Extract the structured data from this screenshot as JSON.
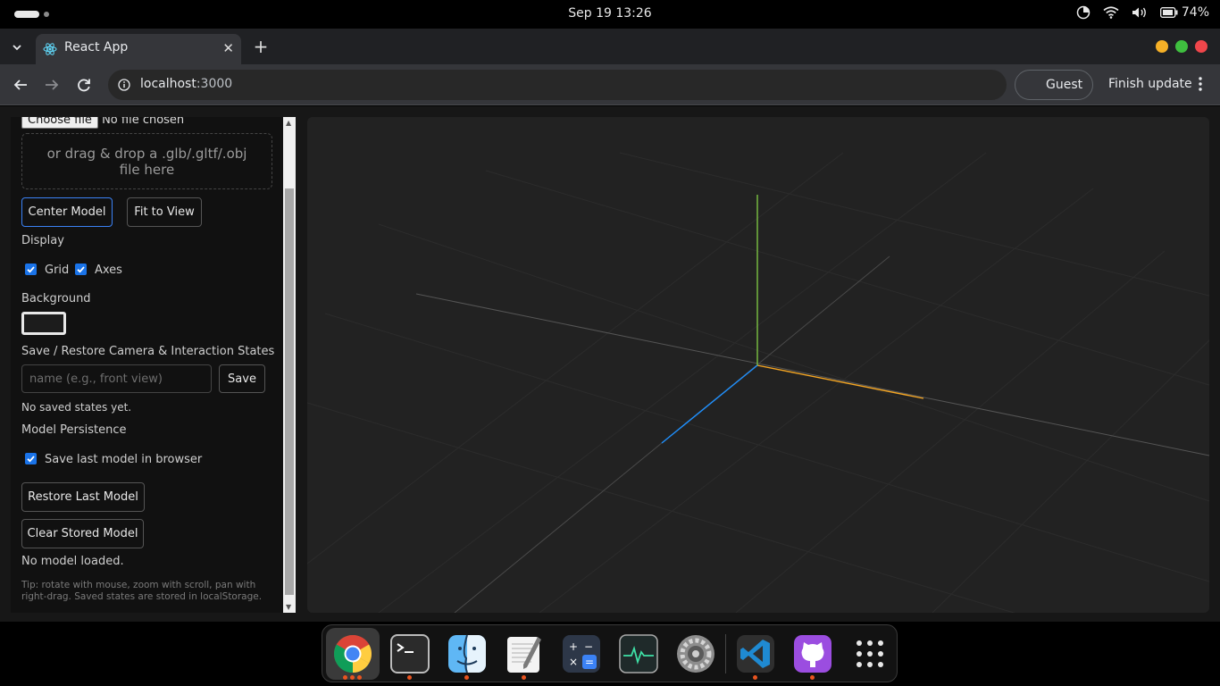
{
  "system": {
    "clock": "Sep 19  13:26",
    "battery": "74%"
  },
  "browser": {
    "tab_title": "React App",
    "url_host": "localhost",
    "url_port": ":3000",
    "guest_label": "Guest",
    "finish_update_label": "Finish update"
  },
  "sidebar": {
    "choose_file_label": "Choose file",
    "no_file_text": "No file chosen",
    "dropzone_text": "or drag & drop a .glb/.gltf/.obj file here",
    "center_model_label": "Center Model",
    "fit_to_view_label": "Fit to View",
    "display_heading": "Display",
    "grid_label": "Grid",
    "axes_label": "Axes",
    "background_heading": "Background",
    "save_restore_heading": "Save / Restore Camera & Interaction States",
    "name_placeholder": "name (e.g., front view)",
    "save_label": "Save",
    "no_saved_states": "No saved states yet.",
    "model_persistence_heading": "Model Persistence",
    "save_last_model_label": "Save last model in browser",
    "restore_last_model_label": "Restore Last Model",
    "clear_stored_model_label": "Clear Stored Model",
    "status_text": "No model loaded.",
    "tip_text": "Tip: rotate with mouse, zoom with scroll, pan with right-drag. Saved states are stored in localStorage."
  },
  "colors": {
    "accent": "#1a73e8",
    "axis_x": "#f5a623",
    "axis_y": "#7cc243",
    "axis_z": "#1e90ff",
    "viewport_bg": "#222222"
  },
  "dock": {
    "apps": [
      "chrome-icon",
      "terminal-icon",
      "finder-icon",
      "text-editor-icon",
      "calculator-icon",
      "system-monitor-icon",
      "settings-icon",
      "vscode-icon",
      "github-desktop-icon",
      "app-grid-icon"
    ]
  }
}
